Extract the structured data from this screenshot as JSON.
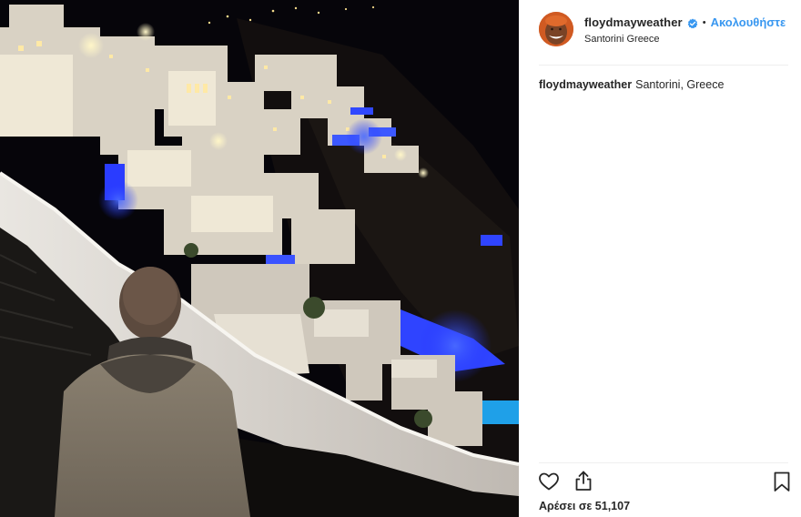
{
  "post": {
    "username": "floydmayweather",
    "verified": true,
    "separator": "•",
    "follow_label": "Ακολουθήστε",
    "location": "Santorini Greece",
    "caption": {
      "username": "floydmayweather",
      "text": "Santorini, Greece"
    },
    "likes_label": "Αρέσει σε 51,107"
  },
  "icons": {
    "like": "heart-outline-icon",
    "share": "share-upload-icon",
    "save": "bookmark-outline-icon",
    "verified": "verified-badge-icon"
  },
  "colors": {
    "link": "#3897f0",
    "text": "#262626",
    "divider": "#efefef",
    "photo_background": "#050407",
    "pool_blue": "#1f3bff"
  }
}
